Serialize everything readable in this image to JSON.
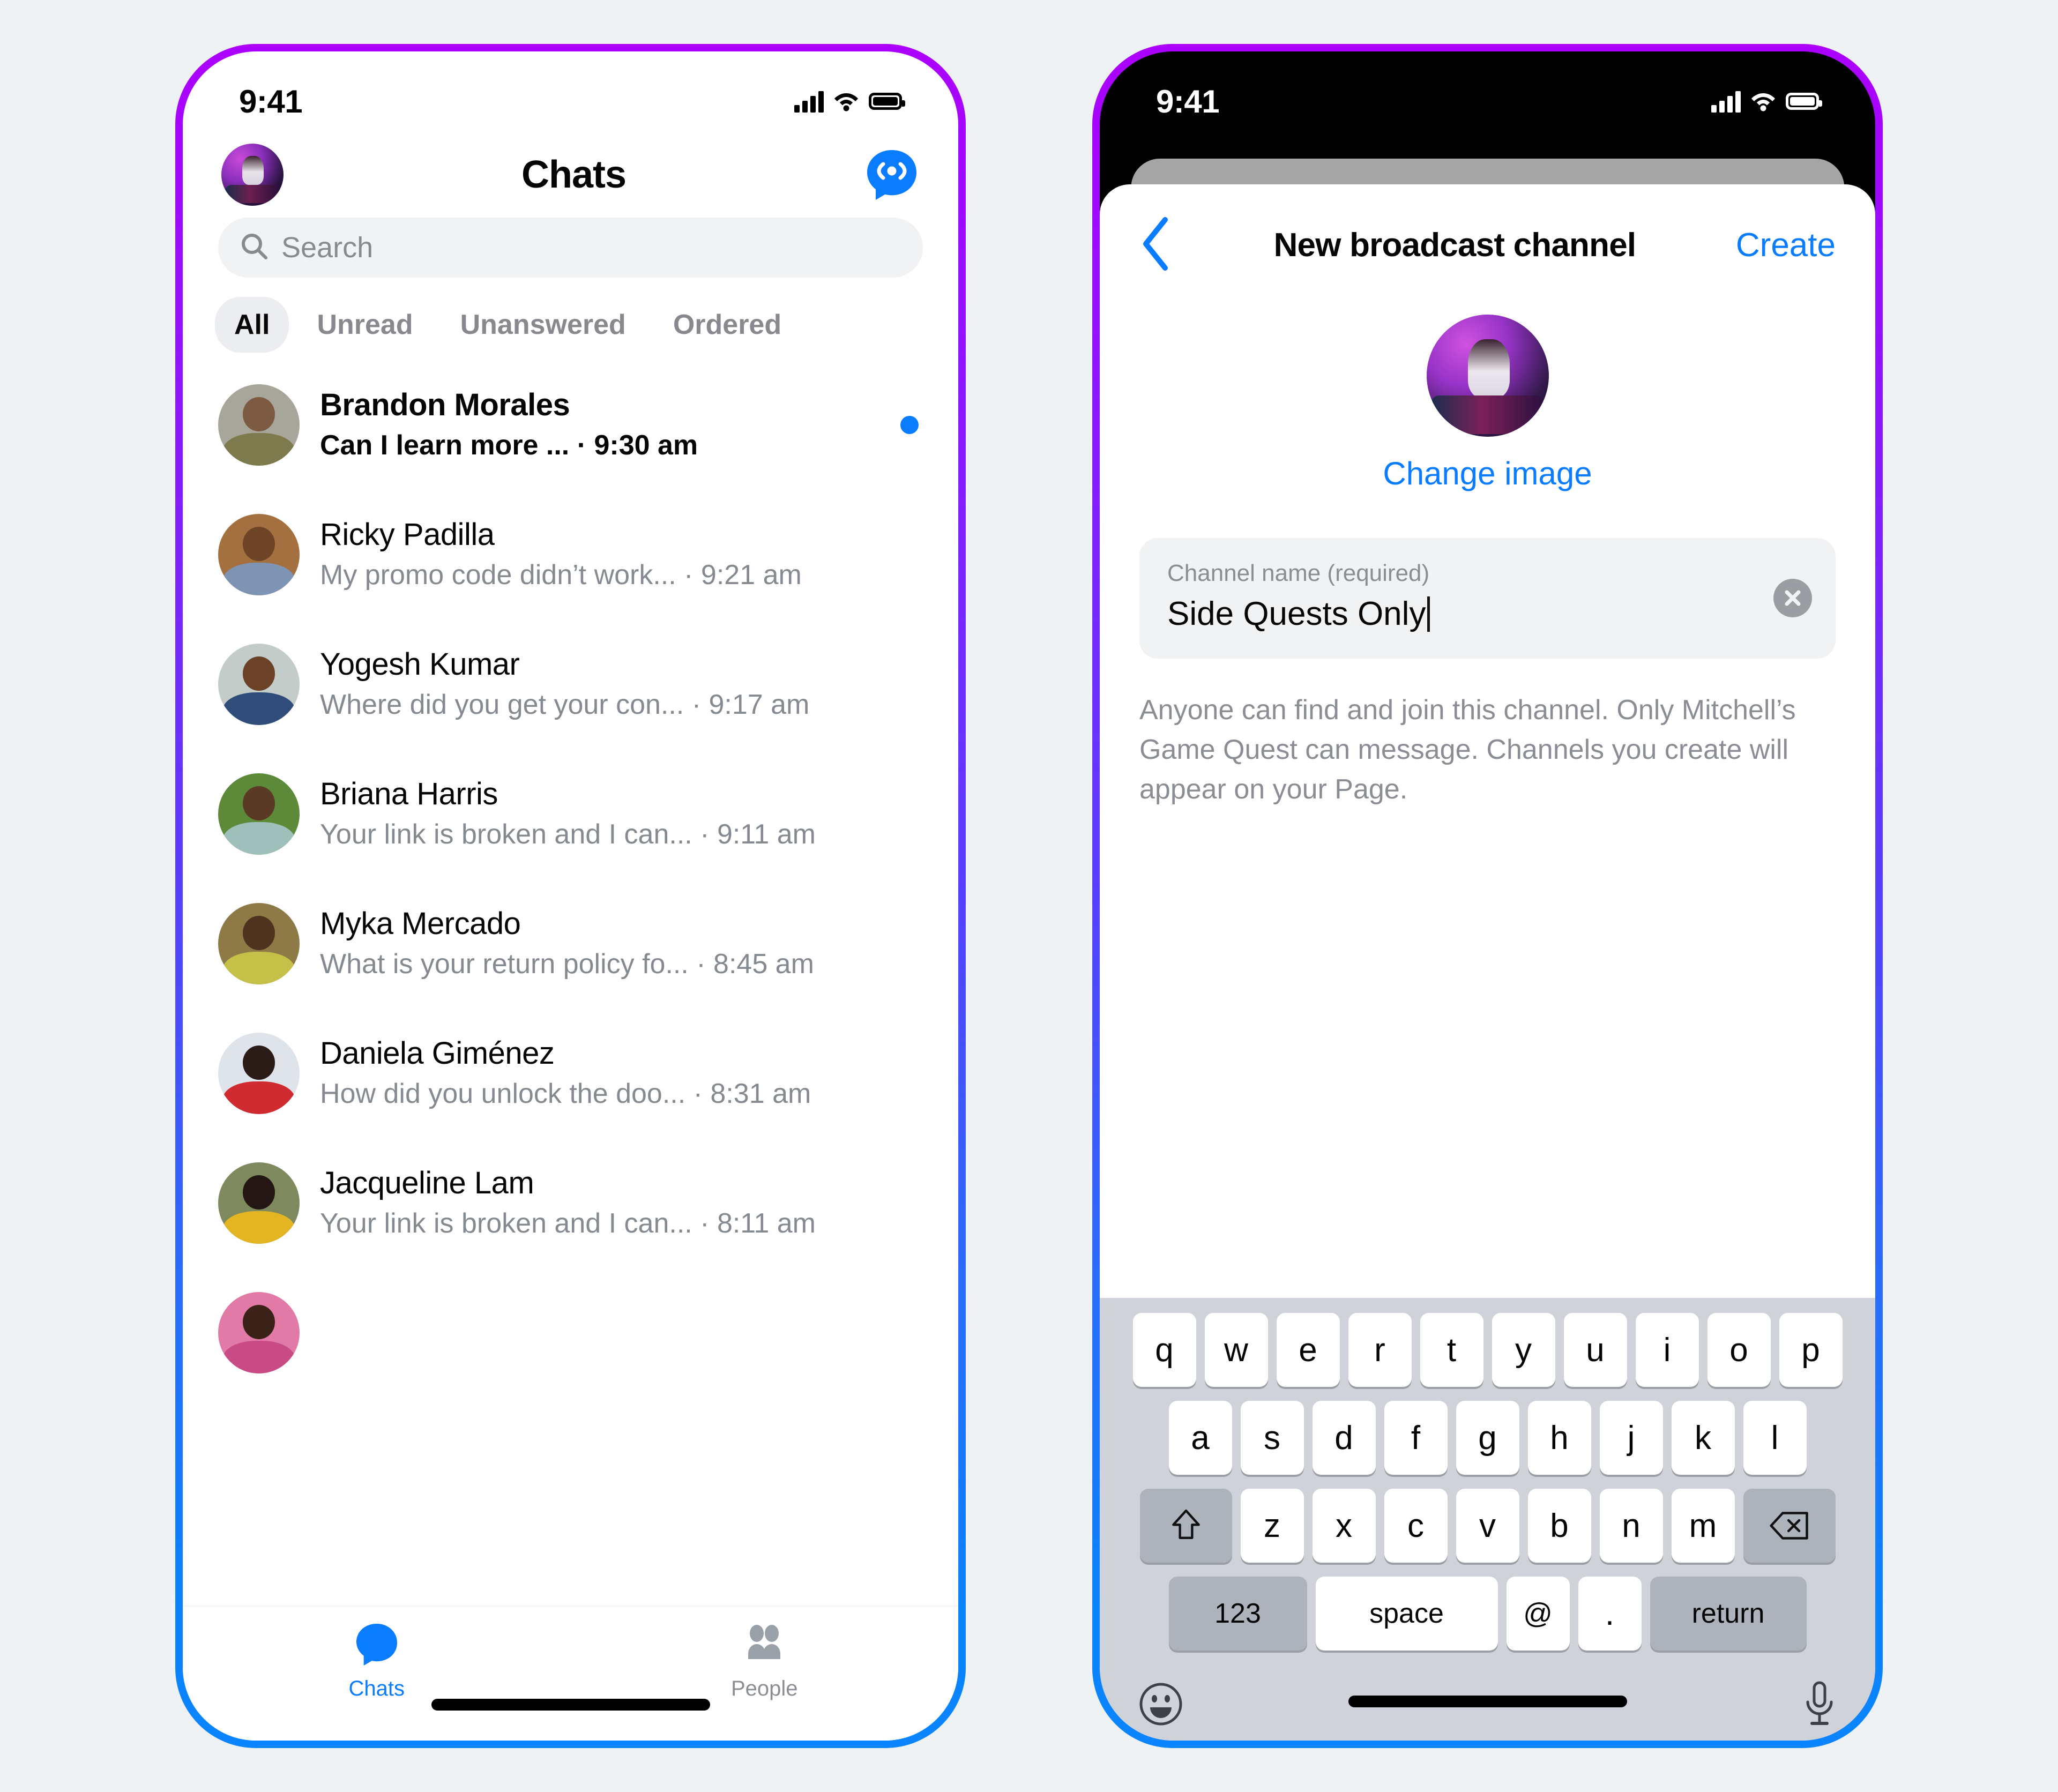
{
  "theme": {
    "page_background": "#eef2f5",
    "frame_gradient_top": "#ad00ff",
    "frame_gradient_bottom": "#0a84ff",
    "accent_blue": "#0a7cff",
    "muted_text": "#8a8d93",
    "chip_bg": "#ebedf0",
    "keyboard_bg": "#cfd3d9"
  },
  "phone1": {
    "status": {
      "time": "9:41",
      "signal_icon": "cellular-bars-icon",
      "wifi_icon": "wifi-icon",
      "battery_icon": "battery-full-icon"
    },
    "header": {
      "avatar_name": "profile-avatar",
      "title": "Chats",
      "broadcast_icon": "broadcast-channel-icon"
    },
    "search": {
      "placeholder": "Search",
      "icon": "search-icon"
    },
    "filters": [
      {
        "label": "All",
        "active": true
      },
      {
        "label": "Unread",
        "active": false
      },
      {
        "label": "Unanswered",
        "active": false
      },
      {
        "label": "Ordered",
        "active": false
      }
    ],
    "chats": [
      {
        "name": "Brandon Morales",
        "snippet": "Can I learn more ...",
        "time": "9:30 am",
        "unread": true
      },
      {
        "name": "Ricky Padilla",
        "snippet": "My promo code didn’t work...",
        "time": "9:21 am",
        "unread": false
      },
      {
        "name": "Yogesh Kumar",
        "snippet": "Where did you get your con...",
        "time": "9:17 am",
        "unread": false
      },
      {
        "name": "Briana Harris",
        "snippet": "Your link is broken and I can...",
        "time": "9:11 am",
        "unread": false
      },
      {
        "name": "Myka Mercado",
        "snippet": "What is your return policy fo...",
        "time": "8:45 am",
        "unread": false
      },
      {
        "name": "Daniela Giménez",
        "snippet": "How did you unlock the doo...",
        "time": "8:31 am",
        "unread": false
      },
      {
        "name": "Jacqueline Lam",
        "snippet": "Your link is broken and I can...",
        "time": "8:11 am",
        "unread": false
      }
    ],
    "tabs": [
      {
        "label": "Chats",
        "icon": "chat-bubble-icon",
        "active": true
      },
      {
        "label": "People",
        "icon": "people-icon",
        "active": false
      }
    ]
  },
  "phone2": {
    "status": {
      "time": "9:41",
      "signal_icon": "cellular-bars-icon",
      "wifi_icon": "wifi-icon",
      "battery_icon": "battery-full-icon"
    },
    "nav": {
      "back_icon": "chevron-left-icon",
      "title": "New broadcast channel",
      "create_label": "Create"
    },
    "channel_image": {
      "avatar_name": "channel-avatar",
      "change_label": "Change image"
    },
    "name_field": {
      "label": "Channel name (required)",
      "value": "Side Quests Only",
      "clear_icon": "clear-circle-icon"
    },
    "helper_text": "Anyone can find and join this channel. Only Mitchell’s Game Quest can message. Channels you create will appear on your Page.",
    "keyboard": {
      "row1": [
        "q",
        "w",
        "e",
        "r",
        "t",
        "y",
        "u",
        "i",
        "o",
        "p"
      ],
      "row2": [
        "a",
        "s",
        "d",
        "f",
        "g",
        "h",
        "j",
        "k",
        "l"
      ],
      "row3": [
        "z",
        "x",
        "c",
        "v",
        "b",
        "n",
        "m"
      ],
      "shift_icon": "shift-arrow-icon",
      "delete_icon": "backspace-icon",
      "numbers_label": "123",
      "space_label": "space",
      "at_label": "@",
      "period_label": ".",
      "return_label": "return",
      "emoji_icon": "emoji-smiley-icon",
      "mic_icon": "microphone-icon"
    }
  }
}
